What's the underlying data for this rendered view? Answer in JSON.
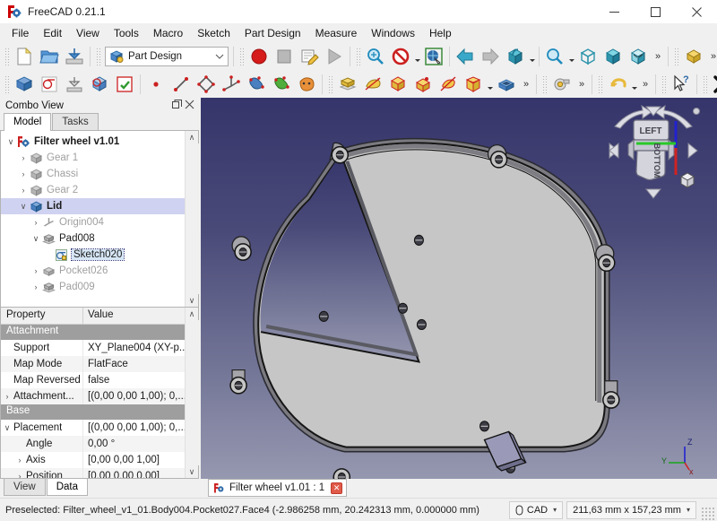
{
  "window": {
    "app_icon": "freecad-logo-icon",
    "title": "FreeCAD 0.21.1",
    "minimize_label": "—",
    "maximize_label": "□",
    "close_label": "×"
  },
  "menubar": {
    "items": [
      {
        "label": "File"
      },
      {
        "label": "Edit"
      },
      {
        "label": "View"
      },
      {
        "label": "Tools"
      },
      {
        "label": "Macro"
      },
      {
        "label": "Sketch"
      },
      {
        "label": "Part Design"
      },
      {
        "label": "Measure"
      },
      {
        "label": "Windows"
      },
      {
        "label": "Help"
      }
    ]
  },
  "toolbars": {
    "workbench_selector": {
      "value": "Part Design",
      "icon": "part-design-workbench-icon",
      "chevron": "∨"
    },
    "row1": [
      {
        "name": "new-document-button",
        "icon": "new-file-icon"
      },
      {
        "name": "open-document-button",
        "icon": "open-folder-icon"
      },
      {
        "name": "save-document-button",
        "icon": "save-icon"
      },
      {
        "name": "macro-record-button",
        "icon": "record-red-circle-icon"
      },
      {
        "name": "macro-stop-button",
        "icon": "stop-square-icon"
      },
      {
        "name": "macros-button",
        "icon": "macro-edit-icon"
      },
      {
        "name": "macro-execute-button",
        "icon": "play-triangle-icon"
      },
      {
        "name": "std-view-fit-button",
        "icon": "fit-all-magnifier-icon"
      },
      {
        "name": "draw-style-button",
        "icon": "draw-style-no-icon"
      },
      {
        "name": "toggle-axis-cross-button",
        "icon": "axis-cross-globe-icon"
      },
      {
        "name": "back-view-button",
        "icon": "arrow-left-blue-icon"
      },
      {
        "name": "forward-view-button",
        "icon": "arrow-right-gray-icon"
      },
      {
        "name": "std-views-button",
        "icon": "isometric-cube-icon"
      },
      {
        "name": "zoom-button",
        "icon": "zoom-magnifier-icon"
      },
      {
        "name": "fit-selection-button",
        "icon": "bounding-box-icon"
      },
      {
        "name": "axonometric-button",
        "icon": "axonometric-cube-icon"
      },
      {
        "name": "measure-cube-button",
        "icon": "measure-cube-icon"
      },
      {
        "name": "overflow-row1-button",
        "icon": "chevron-double-right-icon"
      },
      {
        "name": "part-pad-button",
        "icon": "pad-yellow-icon"
      },
      {
        "name": "overflow-row1b-button",
        "icon": "chevron-double-right-icon"
      }
    ],
    "row2": [
      {
        "name": "create-body-button",
        "icon": "body-blue-icon"
      },
      {
        "name": "create-sketch-button",
        "icon": "sketch-red-icon"
      },
      {
        "name": "attach-sketch-button",
        "icon": "attach-sketch-icon"
      },
      {
        "name": "validate-sketch-button",
        "icon": "validate-sketch-icon"
      },
      {
        "name": "leave-sketch-button",
        "icon": "leave-sketch-green-icon"
      },
      {
        "name": "create-point-button",
        "icon": "point-icon"
      },
      {
        "name": "create-line-button",
        "icon": "line-icon"
      },
      {
        "name": "create-polyline-button",
        "icon": "polyline-icon"
      },
      {
        "name": "create-datum-button",
        "icon": "datum-icon"
      },
      {
        "name": "shape-binder-button",
        "icon": "shape-binder-blue-icon"
      },
      {
        "name": "sub-shape-binder-button",
        "icon": "sub-binder-green-icon"
      },
      {
        "name": "clone-button",
        "icon": "clone-orange-icon"
      },
      {
        "name": "pad-button",
        "icon": "pad-yellow-layers-icon"
      },
      {
        "name": "revolution-button",
        "icon": "revolution-yellow-icon"
      },
      {
        "name": "pocket-button",
        "icon": "pocket-red-icon"
      },
      {
        "name": "hole-button",
        "icon": "hole-red-icon"
      },
      {
        "name": "groove-button",
        "icon": "groove-red-icon"
      },
      {
        "name": "additive-primitive-button",
        "icon": "additive-box-icon"
      },
      {
        "name": "subtractive-primitive-button",
        "icon": "subtractive-box-blue-icon"
      },
      {
        "name": "overflow-row2-button",
        "icon": "chevron-double-right-icon"
      },
      {
        "name": "measure-button",
        "icon": "measure-tape-icon"
      },
      {
        "name": "overflow-row2b-button",
        "icon": "chevron-double-right-icon"
      },
      {
        "name": "undo-button",
        "icon": "undo-yellow-arrow-icon"
      },
      {
        "name": "overflow-row2c-button",
        "icon": "chevron-double-right-icon"
      },
      {
        "name": "whats-this-button",
        "icon": "whats-this-cursor-icon"
      },
      {
        "name": "close-x-button",
        "icon": "black-x-icon"
      },
      {
        "name": "overflow-row2d-button",
        "icon": "chevron-double-right-icon"
      }
    ]
  },
  "combo_view": {
    "title": "Combo View",
    "float_label": "❐",
    "close_label": "✕",
    "tabs": [
      {
        "label": "Model",
        "active": true
      },
      {
        "label": "Tasks",
        "active": false
      }
    ],
    "tree": [
      {
        "label": "Filter wheel v1.01",
        "depth": 0,
        "twisty": "∨",
        "icon": "document-icon",
        "bold": true,
        "dim": false,
        "selected": false,
        "editbox": false
      },
      {
        "label": "Gear 1",
        "depth": 1,
        "twisty": "›",
        "icon": "body-gray-icon",
        "bold": false,
        "dim": true,
        "selected": false,
        "editbox": false
      },
      {
        "label": "Chassi",
        "depth": 1,
        "twisty": "›",
        "icon": "body-gray-icon",
        "bold": false,
        "dim": true,
        "selected": false,
        "editbox": false
      },
      {
        "label": "Gear 2",
        "depth": 1,
        "twisty": "›",
        "icon": "body-gray-icon",
        "bold": false,
        "dim": true,
        "selected": false,
        "editbox": false
      },
      {
        "label": "Lid",
        "depth": 1,
        "twisty": "∨",
        "icon": "body-blue-icon",
        "bold": true,
        "dim": false,
        "selected": true,
        "editbox": false
      },
      {
        "label": "Origin004",
        "depth": 2,
        "twisty": "›",
        "icon": "origin-icon",
        "bold": false,
        "dim": true,
        "selected": false,
        "editbox": false
      },
      {
        "label": "Pad008",
        "depth": 2,
        "twisty": "∨",
        "icon": "pad-feature-icon",
        "bold": false,
        "dim": false,
        "selected": false,
        "editbox": false
      },
      {
        "label": "Sketch020",
        "depth": 3,
        "twisty": "",
        "icon": "sketch-feature-icon",
        "bold": false,
        "dim": false,
        "selected": false,
        "editbox": true
      },
      {
        "label": "Pocket026",
        "depth": 2,
        "twisty": "›",
        "icon": "pocket-feature-icon",
        "bold": false,
        "dim": true,
        "selected": false,
        "editbox": false
      },
      {
        "label": "Pad009",
        "depth": 2,
        "twisty": "›",
        "icon": "pad-feature-icon",
        "bold": false,
        "dim": true,
        "selected": false,
        "editbox": false
      }
    ],
    "tree_scroll": {
      "up": "∧",
      "down": "∨"
    },
    "property_editor": {
      "headers": {
        "property": "Property",
        "value": "Value"
      },
      "rows": [
        {
          "type": "group",
          "label": "Attachment"
        },
        {
          "type": "row",
          "name": "Support",
          "value": "XY_Plane004 (XY-p...",
          "indent": 1,
          "expander": ""
        },
        {
          "type": "row",
          "name": "Map Mode",
          "value": "FlatFace",
          "indent": 1,
          "expander": ""
        },
        {
          "type": "row",
          "name": "Map Reversed",
          "value": "false",
          "indent": 1,
          "expander": ""
        },
        {
          "type": "row",
          "name": "Attachment...",
          "value": "[(0,00 0,00 1,00); 0,...",
          "indent": 0,
          "expander": "›"
        },
        {
          "type": "group",
          "label": "Base"
        },
        {
          "type": "row",
          "name": "Placement",
          "value": "[(0,00 0,00 1,00); 0,...",
          "indent": 0,
          "expander": "∨"
        },
        {
          "type": "row",
          "name": "Angle",
          "value": "0,00 °",
          "indent": 2,
          "expander": ""
        },
        {
          "type": "row",
          "name": "Axis",
          "value": "[0,00 0,00 1,00]",
          "indent": 1,
          "expander": "›"
        },
        {
          "type": "row",
          "name": "Position",
          "value": "[0,00 0,00 0,00]",
          "indent": 1,
          "expander": "›"
        }
      ],
      "scroll": {
        "up": "∧",
        "down": "∨"
      }
    },
    "bottom_tabs": [
      {
        "label": "View",
        "active": false
      },
      {
        "label": "Data",
        "active": true
      }
    ]
  },
  "view3d": {
    "navigation_cube": {
      "top_face": "LEFT",
      "front_face": "BOTTOM"
    },
    "axis_labels": {
      "x": "x",
      "y": "Y",
      "z": "Z"
    },
    "colors": {
      "bg_top": "#35356b",
      "bg_bottom": "#9496ae",
      "model_face": "#c8c8c8",
      "model_edge": "#1a1a1a",
      "model_side": "#8c8c8c",
      "highlight_face": "#9a9ab8"
    }
  },
  "document_tabs": [
    {
      "label": "Filter wheel v1.01 : 1",
      "icon": "freecad-logo-icon",
      "close": "✕",
      "active": true
    }
  ],
  "statusbar": {
    "message": "Preselected: Filter_wheel_v1_01.Body004.Pocket027.Face4 (-2.986258 mm, 20.242313 mm, 0.000000 mm)",
    "unit_system": {
      "icon": "unit-icon",
      "label": "CAD",
      "chevron": "▾"
    },
    "dimensions": {
      "label": "211,63 mm x 157,23 mm",
      "chevron": "▾"
    }
  }
}
